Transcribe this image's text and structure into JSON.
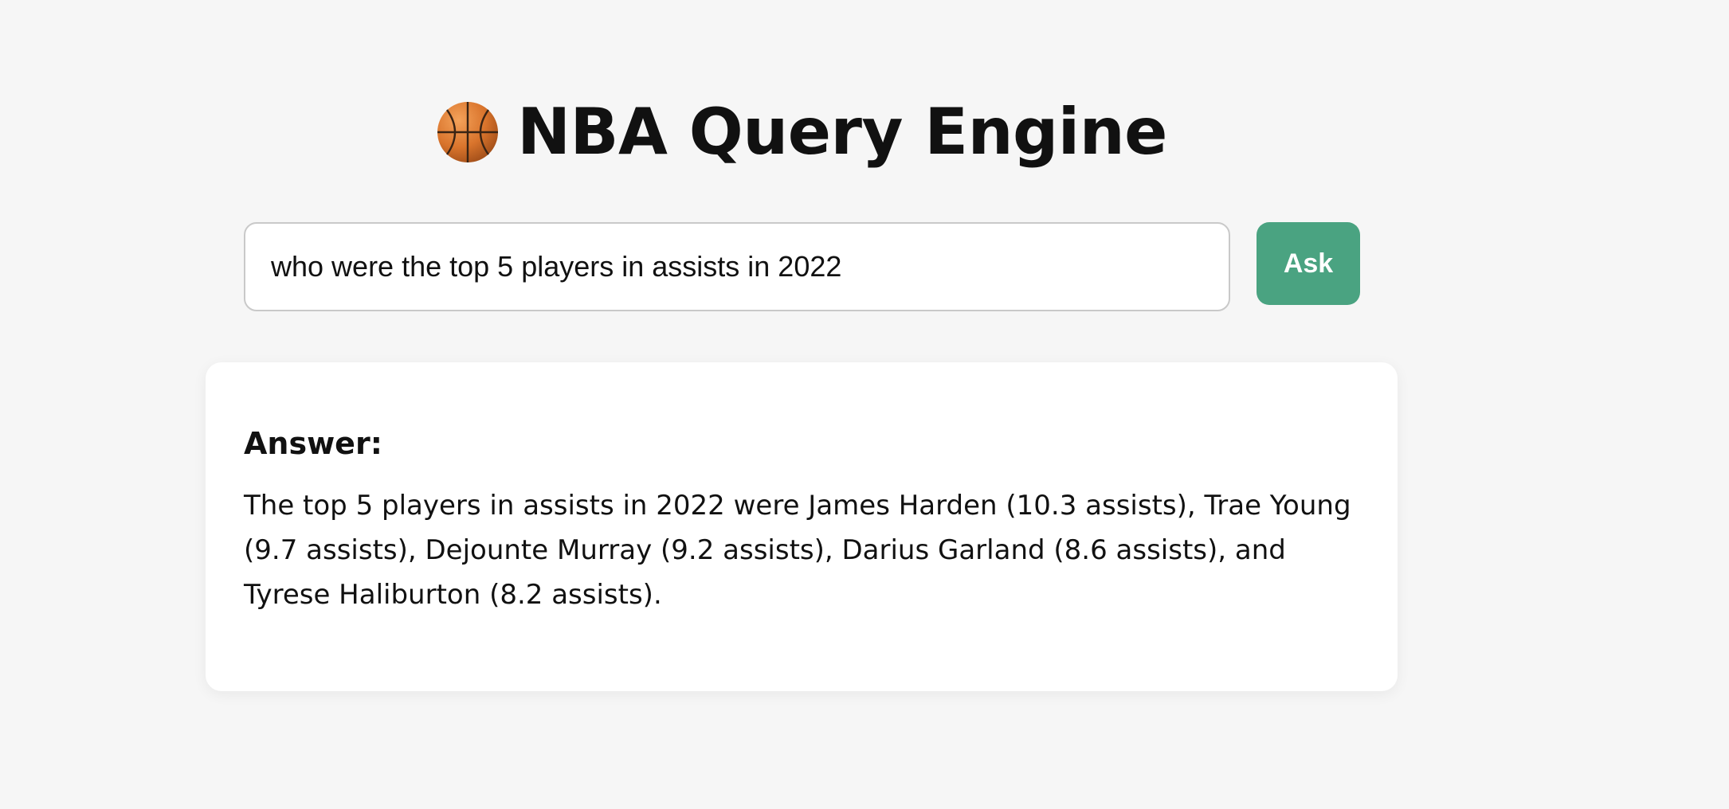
{
  "header": {
    "icon": "basketball-icon",
    "title": "NBA Query Engine"
  },
  "search": {
    "value": "who were the top 5 players in assists in 2022",
    "button_label": "Ask",
    "button_color": "#4aa381"
  },
  "answer": {
    "heading": "Answer:",
    "text": "The top 5 players in assists in 2022 were James Harden (10.3 assists), Trae Young (9.7 assists), Dejounte Murray (9.2 assists), Darius Garland (8.6 assists), and Tyrese Haliburton (8.2 assists)."
  }
}
